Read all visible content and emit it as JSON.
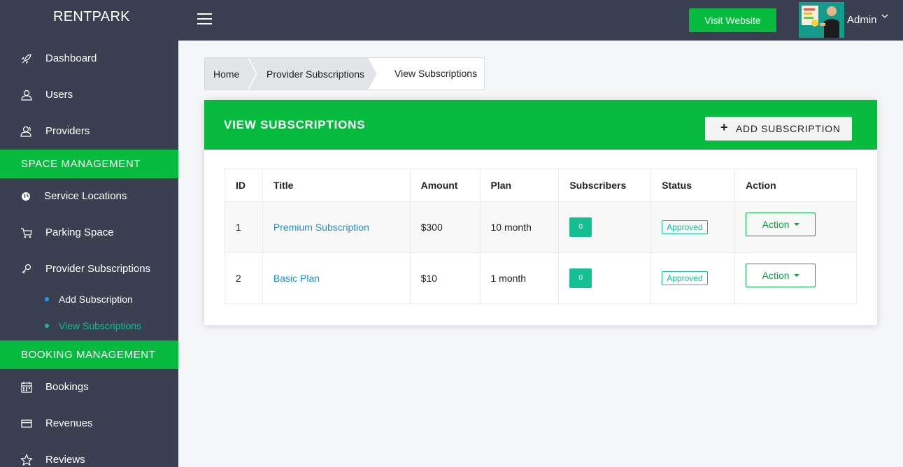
{
  "brand": "RENTPARK",
  "topbar": {
    "visit_label": "Visit Website",
    "admin_label": "Admin"
  },
  "sidebar": {
    "items": [
      {
        "label": "Dashboard",
        "icon": "rocket-icon"
      },
      {
        "label": "Users",
        "icon": "user-icon"
      },
      {
        "label": "Providers",
        "icon": "users-icon"
      }
    ],
    "section_space": "SPACE MANAGEMENT",
    "space_items": [
      {
        "label": "Service Locations",
        "icon": "globe-icon"
      },
      {
        "label": "Parking Space",
        "icon": "cart-icon"
      },
      {
        "label": "Provider Subscriptions",
        "icon": "key-icon"
      }
    ],
    "sub_items": [
      {
        "label": "Add Subscription",
        "active": false
      },
      {
        "label": "View Subscriptions",
        "active": true
      }
    ],
    "section_booking": "BOOKING MANAGEMENT",
    "booking_items": [
      {
        "label": "Bookings",
        "icon": "calendar-icon"
      },
      {
        "label": "Revenues",
        "icon": "credit-card-icon"
      },
      {
        "label": "Reviews",
        "icon": "star-icon"
      }
    ]
  },
  "breadcrumb": {
    "home": "Home",
    "parent": "Provider Subscriptions",
    "current": "View Subscriptions"
  },
  "card": {
    "title": "VIEW SUBSCRIPTIONS",
    "add_label": "ADD SUBSCRIPTION"
  },
  "table": {
    "headers": [
      "ID",
      "Title",
      "Amount",
      "Plan",
      "Subscribers",
      "Status",
      "Action"
    ],
    "rows": [
      {
        "id": "1",
        "title": "Premium Subscription",
        "amount": "$300",
        "plan": "10 month",
        "subscribers": "0",
        "status": "Approved",
        "action": "Action"
      },
      {
        "id": "2",
        "title": "Basic Plan",
        "amount": "$10",
        "plan": "1 month",
        "subscribers": "0",
        "status": "Approved",
        "action": "Action"
      }
    ]
  },
  "colors": {
    "accent": "#06bb3e",
    "sidebar": "#3a3f51",
    "badge": "#14bf94",
    "link": "#1d8fe0",
    "active_sub": "#14bf94",
    "dot_inactive": "#1d9bf0"
  }
}
